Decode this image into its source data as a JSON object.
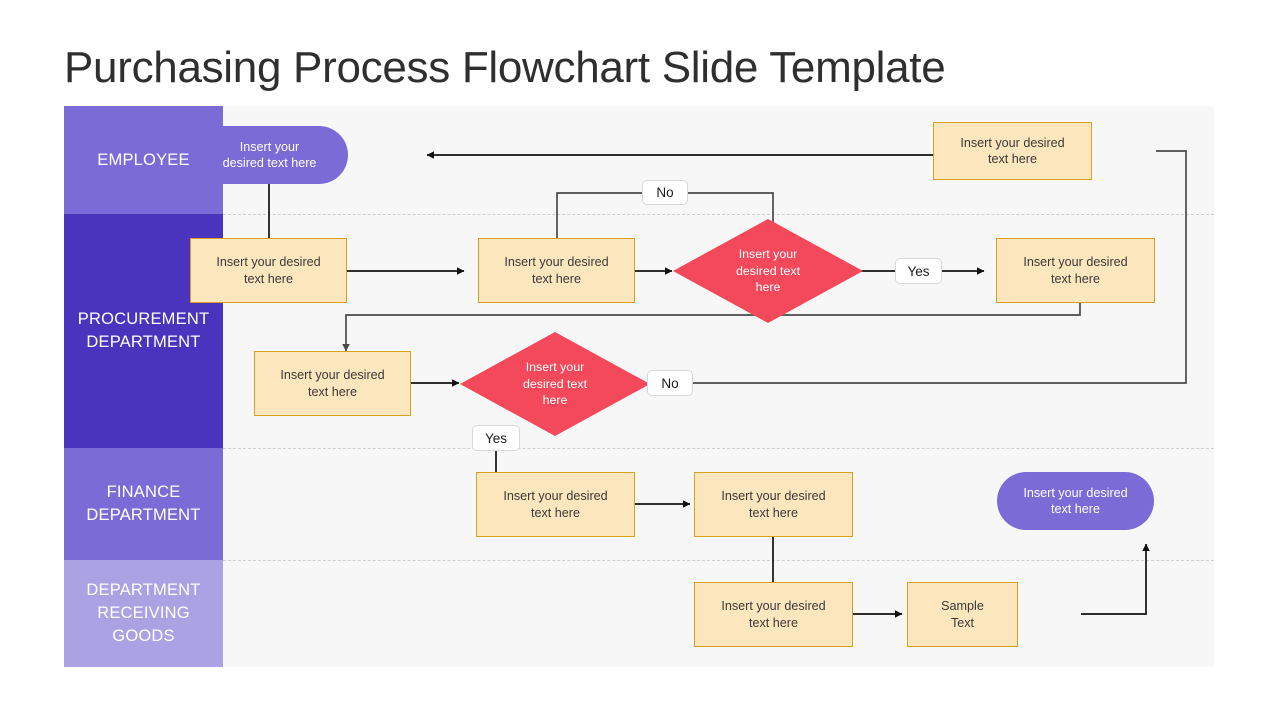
{
  "slide": {
    "title": "Purchasing Process Flowchart Slide Template"
  },
  "colors": {
    "lane_employee": "#7b6bd6",
    "lane_procurement": "#4a33bd",
    "lane_finance": "#7b6bd6",
    "lane_receiving": "#aaa2e3",
    "box_fill": "#fce6bd",
    "box_border": "#d6a21f",
    "pill_fill": "#7b6bd6",
    "diamond_fill": "#f4485b",
    "canvas_bg": "#f7f7f7",
    "connector": "#1a1a1a",
    "lane_divider": "#cfcfcf",
    "title_text": "#2f2f2f"
  },
  "lanes": [
    {
      "id": "employee",
      "label": "EMPLOYEE"
    },
    {
      "id": "procurement",
      "label": "PROCUREMENT\nDEPARTMENT"
    },
    {
      "id": "finance",
      "label": "FINANCE\nDEPARTMENT"
    },
    {
      "id": "receiving",
      "label": "DEPARTMENT\nRECEIVING\nGOODS"
    }
  ],
  "nodes": [
    {
      "id": "start",
      "shape": "pill",
      "lane": "employee",
      "text": "Insert your\ndesired text here"
    },
    {
      "id": "emp_r",
      "shape": "box",
      "lane": "employee",
      "text": "Insert your desired\ntext here"
    },
    {
      "id": "proc1",
      "shape": "box",
      "lane": "procurement",
      "text": "Insert your desired\ntext here"
    },
    {
      "id": "proc2",
      "shape": "box",
      "lane": "procurement",
      "text": "Insert your desired\ntext here"
    },
    {
      "id": "dec1",
      "shape": "diamond",
      "lane": "procurement",
      "text": "Insert your\ndesired text\nhere"
    },
    {
      "id": "proc3",
      "shape": "box",
      "lane": "procurement",
      "text": "Insert your desired\ntext here"
    },
    {
      "id": "proc4",
      "shape": "box",
      "lane": "procurement",
      "text": "Insert your desired\ntext here"
    },
    {
      "id": "dec2",
      "shape": "diamond",
      "lane": "procurement",
      "text": "Insert your\ndesired text\nhere"
    },
    {
      "id": "fin1",
      "shape": "box",
      "lane": "finance",
      "text": "Insert your desired\ntext here"
    },
    {
      "id": "fin2",
      "shape": "box",
      "lane": "finance",
      "text": "Insert your desired\ntext here"
    },
    {
      "id": "end",
      "shape": "pill",
      "lane": "finance",
      "text": "Insert your desired\ntext here"
    },
    {
      "id": "recv1",
      "shape": "box",
      "lane": "receiving",
      "text": "Insert your desired\ntext here"
    },
    {
      "id": "recv2",
      "shape": "box",
      "lane": "receiving",
      "text": "Sample\nText"
    }
  ],
  "edge_labels": {
    "no_top": "No",
    "yes_dec1": "Yes",
    "no_dec2": "No",
    "yes_dec2": "Yes"
  }
}
